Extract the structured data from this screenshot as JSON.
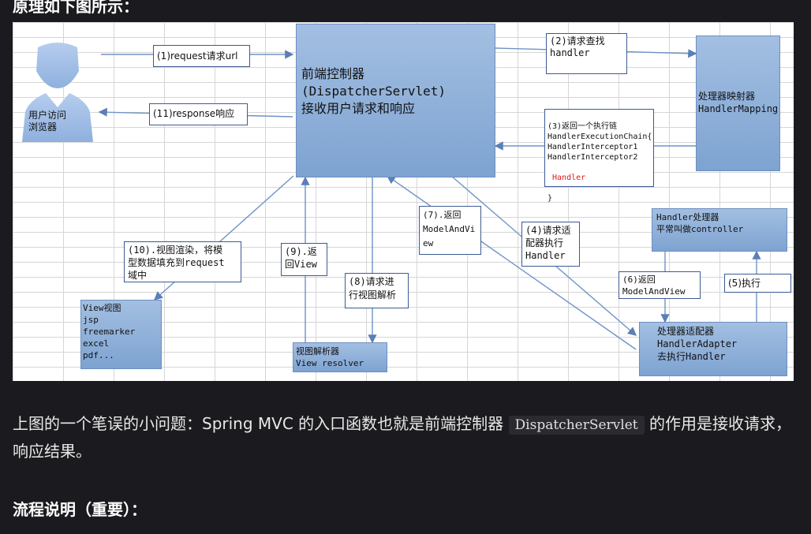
{
  "heading": "原理如下图所示：",
  "diagram": {
    "user": "用户访问\n浏览器",
    "front_controller": "前端控制器\n(DispatcherServlet)\n接收用户请求和响应",
    "handler_mapping": "处理器映射器\nHandlerMapping",
    "handler_adapter": "处理器适配器\nHandlerAdapter\n去执行Handler",
    "handler": "Handler处理器\n平常叫做controller",
    "view_resolver": "视图解析器\nView resolver",
    "view": "View视图\njsp\nfreemarker\nexcel\npdf...",
    "step1": "(1)request请求url",
    "step2": "(2)请求查找\nhandler",
    "step3_lines": "(3)返回一个执行链\nHandlerExecutionChain{\n HandlerInterceptor1\n HandlerInterceptor2",
    "step3_handler": " Handler",
    "step3_close": "}",
    "step4": "(4)请求适\n配器执行\nHandler",
    "step5": "(5)执行",
    "step6": "(6)返回\nModelAndView",
    "step7": "(7).返回\nModelAndVi\new",
    "step8": "(8)请求进\n行视图解析",
    "step9": "(9).返\n回View",
    "step10": "(10).视图渲染，将模\n型数据填充到request\n域中",
    "step11": "(11)response响应"
  },
  "paragraph": {
    "before": "上图的一个笔误的小问题：Spring MVC 的入口函数也就是前端控制器",
    "code": "DispatcherServlet",
    "after": "的作用是接收请求，响应结果。"
  },
  "subheading": "流程说明（重要）："
}
